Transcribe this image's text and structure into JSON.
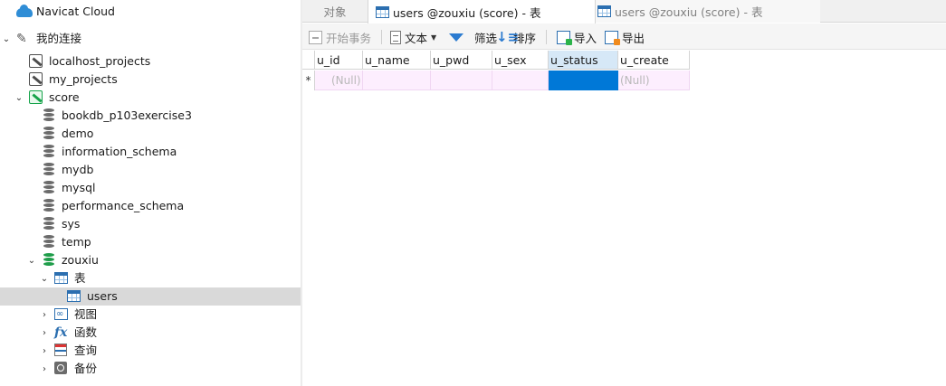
{
  "sidebar": {
    "cloud_label": "Navicat Cloud",
    "my_connections_label": "我的连接",
    "connections": [
      {
        "label": "localhost_projects"
      },
      {
        "label": "my_projects"
      },
      {
        "label": "score"
      }
    ],
    "databases": [
      {
        "label": "bookdb_p103exercise3"
      },
      {
        "label": "demo"
      },
      {
        "label": "information_schema"
      },
      {
        "label": "mydb"
      },
      {
        "label": "mysql"
      },
      {
        "label": "performance_schema"
      },
      {
        "label": "sys"
      },
      {
        "label": "temp"
      },
      {
        "label": "zouxiu"
      }
    ],
    "zouxiu_children": {
      "tables_label": "表",
      "selected_table": "users",
      "views_label": "视图",
      "functions_label": "函数",
      "queries_label": "查询",
      "backups_label": "备份"
    }
  },
  "tabs": [
    {
      "label": "对象",
      "active": false
    },
    {
      "label": "users @zouxiu (score) - 表",
      "active": true
    },
    {
      "label": "users @zouxiu (score) - 表",
      "active": false
    }
  ],
  "toolbar": {
    "begin_transaction": "开始事务",
    "text": "文本",
    "filter": "筛选",
    "sort": "排序",
    "import": "导入",
    "export": "导出"
  },
  "grid": {
    "columns": [
      "u_id",
      "u_name",
      "u_pwd",
      "u_sex",
      "u_status",
      "u_create"
    ],
    "selected_column": "u_status",
    "row_marker": "*",
    "new_row": [
      "(Null)",
      "",
      "",
      "",
      "",
      "(Null)"
    ]
  },
  "colors": {
    "selection_blue": "#0078d7",
    "new_row_pink": "#fdeefe",
    "sidebar_selected": "#d9d9d9"
  }
}
